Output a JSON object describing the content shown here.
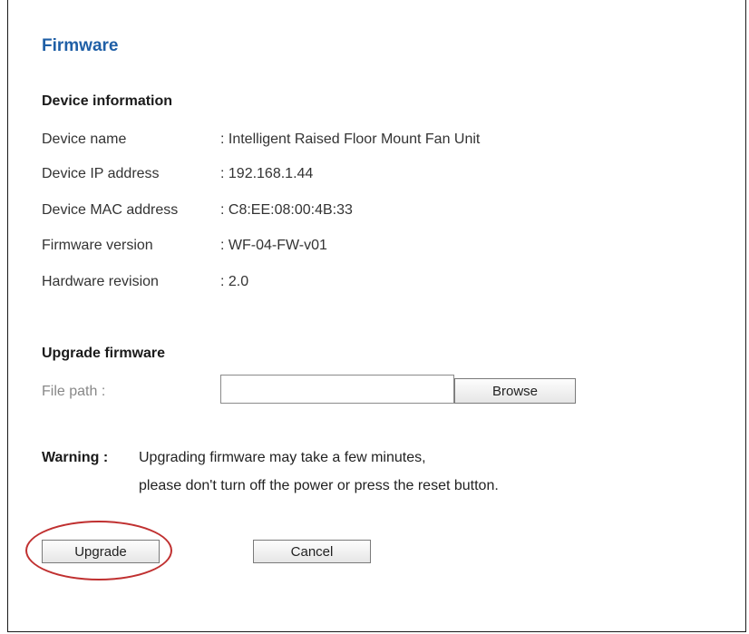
{
  "page": {
    "title": "Firmware"
  },
  "device_info": {
    "heading": "Device information",
    "rows": [
      {
        "label": "Device name",
        "value": ": Intelligent Raised Floor Mount Fan Unit"
      },
      {
        "label": "Device IP address",
        "value": ": 192.168.1.44"
      },
      {
        "label": "Device MAC address",
        "value": ": C8:EE:08:00:4B:33"
      },
      {
        "label": "Firmware version",
        "value": ": WF-04-FW-v01"
      },
      {
        "label": "Hardware revision",
        "value": ": 2.0"
      }
    ]
  },
  "upgrade": {
    "heading": "Upgrade firmware",
    "file_label": "File path :",
    "file_value": "",
    "browse_label": "Browse"
  },
  "warning": {
    "label": "Warning :",
    "line1": "Upgrading firmware may take a few minutes,",
    "line2": "please don't turn off the power or press the reset button."
  },
  "actions": {
    "upgrade_label": "Upgrade",
    "cancel_label": "Cancel"
  },
  "colors": {
    "title": "#1f5fa6",
    "highlight": "#c03030"
  }
}
